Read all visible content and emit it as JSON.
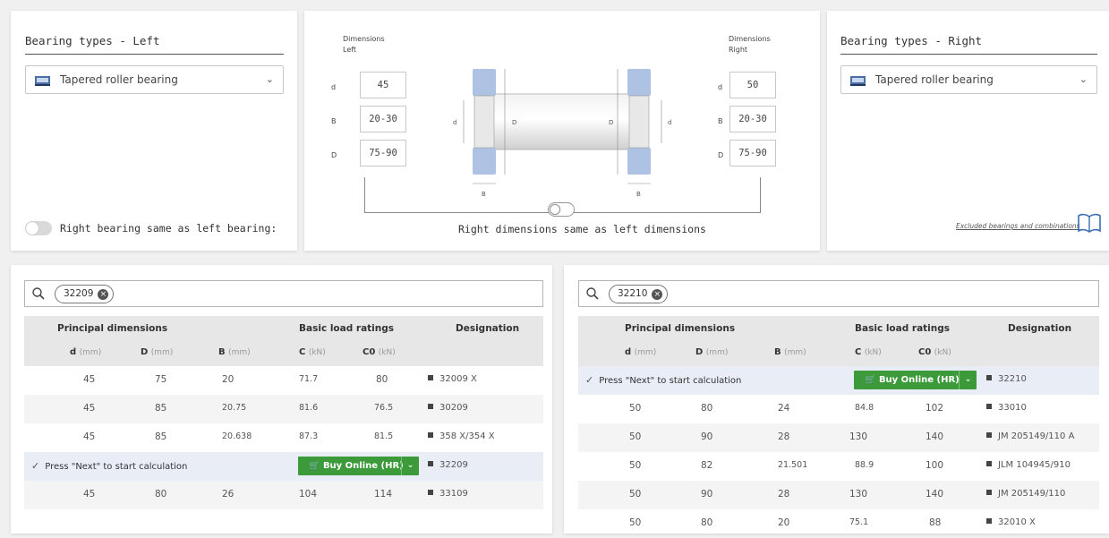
{
  "left_panel": {
    "title": "Bearing types - Left",
    "select_value": "Tapered roller bearing",
    "toggle_label": "Right bearing same as left bearing:"
  },
  "middle_panel": {
    "left_title_1": "Dimensions",
    "left_title_2": "Left",
    "right_title_1": "Dimensions",
    "right_title_2": "Right",
    "left_dims": [
      {
        "label": "d",
        "value": "45"
      },
      {
        "label": "B",
        "value": "20-30"
      },
      {
        "label": "D",
        "value": "75-90"
      }
    ],
    "right_dims": [
      {
        "label": "d",
        "value": "50"
      },
      {
        "label": "B",
        "value": "20-30"
      },
      {
        "label": "D",
        "value": "75-90"
      }
    ],
    "diagram_labels": {
      "d": "d",
      "D": "D",
      "B": "B"
    },
    "toggle_label": "Right dimensions same as left dimensions"
  },
  "right_panel": {
    "title": "Bearing types - Right",
    "select_value": "Tapered roller bearing",
    "excluded_link": "Excluded bearings and combinations"
  },
  "table_headers": {
    "principal": "Principal dimensions",
    "load": "Basic load ratings",
    "designation": "Designation",
    "d": "d",
    "D": "D",
    "B": "B",
    "C": "C",
    "C0": "C0",
    "unit_mm": "(mm)",
    "unit_kn": "(kN)"
  },
  "press_text": "Press \"Next\" to start calculation",
  "buy_label": "Buy Online (HR)",
  "left_table": {
    "search_chip": "32209",
    "rows": [
      {
        "d": "45",
        "D": "75",
        "B": "20",
        "C": "71.7",
        "C0": "80",
        "desig": "32009 X"
      },
      {
        "d": "45",
        "D": "85",
        "B": "20.75",
        "C": "81.6",
        "C0": "76.5",
        "desig": "30209"
      },
      {
        "d": "45",
        "D": "85",
        "B": "20.638",
        "C": "87.3",
        "C0": "81.5",
        "desig": "358 X/354 X"
      },
      {
        "selected": true,
        "desig": "32209"
      },
      {
        "d": "45",
        "D": "80",
        "B": "26",
        "C": "104",
        "C0": "114",
        "desig": "33109"
      }
    ]
  },
  "right_table": {
    "search_chip": "32210",
    "rows": [
      {
        "selected": true,
        "desig": "32210"
      },
      {
        "d": "50",
        "D": "80",
        "B": "24",
        "C": "84.8",
        "C0": "102",
        "desig": "33010"
      },
      {
        "d": "50",
        "D": "90",
        "B": "28",
        "C": "130",
        "C0": "140",
        "desig": "JM 205149/110 A"
      },
      {
        "d": "50",
        "D": "82",
        "B": "21.501",
        "C": "88.9",
        "C0": "100",
        "desig": "JLM 104945/910"
      },
      {
        "d": "50",
        "D": "90",
        "B": "28",
        "C": "130",
        "C0": "140",
        "desig": "JM 205149/110"
      },
      {
        "d": "50",
        "D": "80",
        "B": "20",
        "C": "75.1",
        "C0": "88",
        "desig": "32010 X"
      }
    ]
  },
  "icons": {
    "bearing": "tapered-bearing-icon",
    "chevron": "chevron-down-icon",
    "search": "search-icon",
    "clear": "clear-icon",
    "cart": "cart-icon",
    "check": "check-icon",
    "book": "book-icon"
  },
  "colors": {
    "buy_green": "#3c9a3a",
    "selected_row": "#e8edf6",
    "bearing_blue": "#aec3e4"
  }
}
